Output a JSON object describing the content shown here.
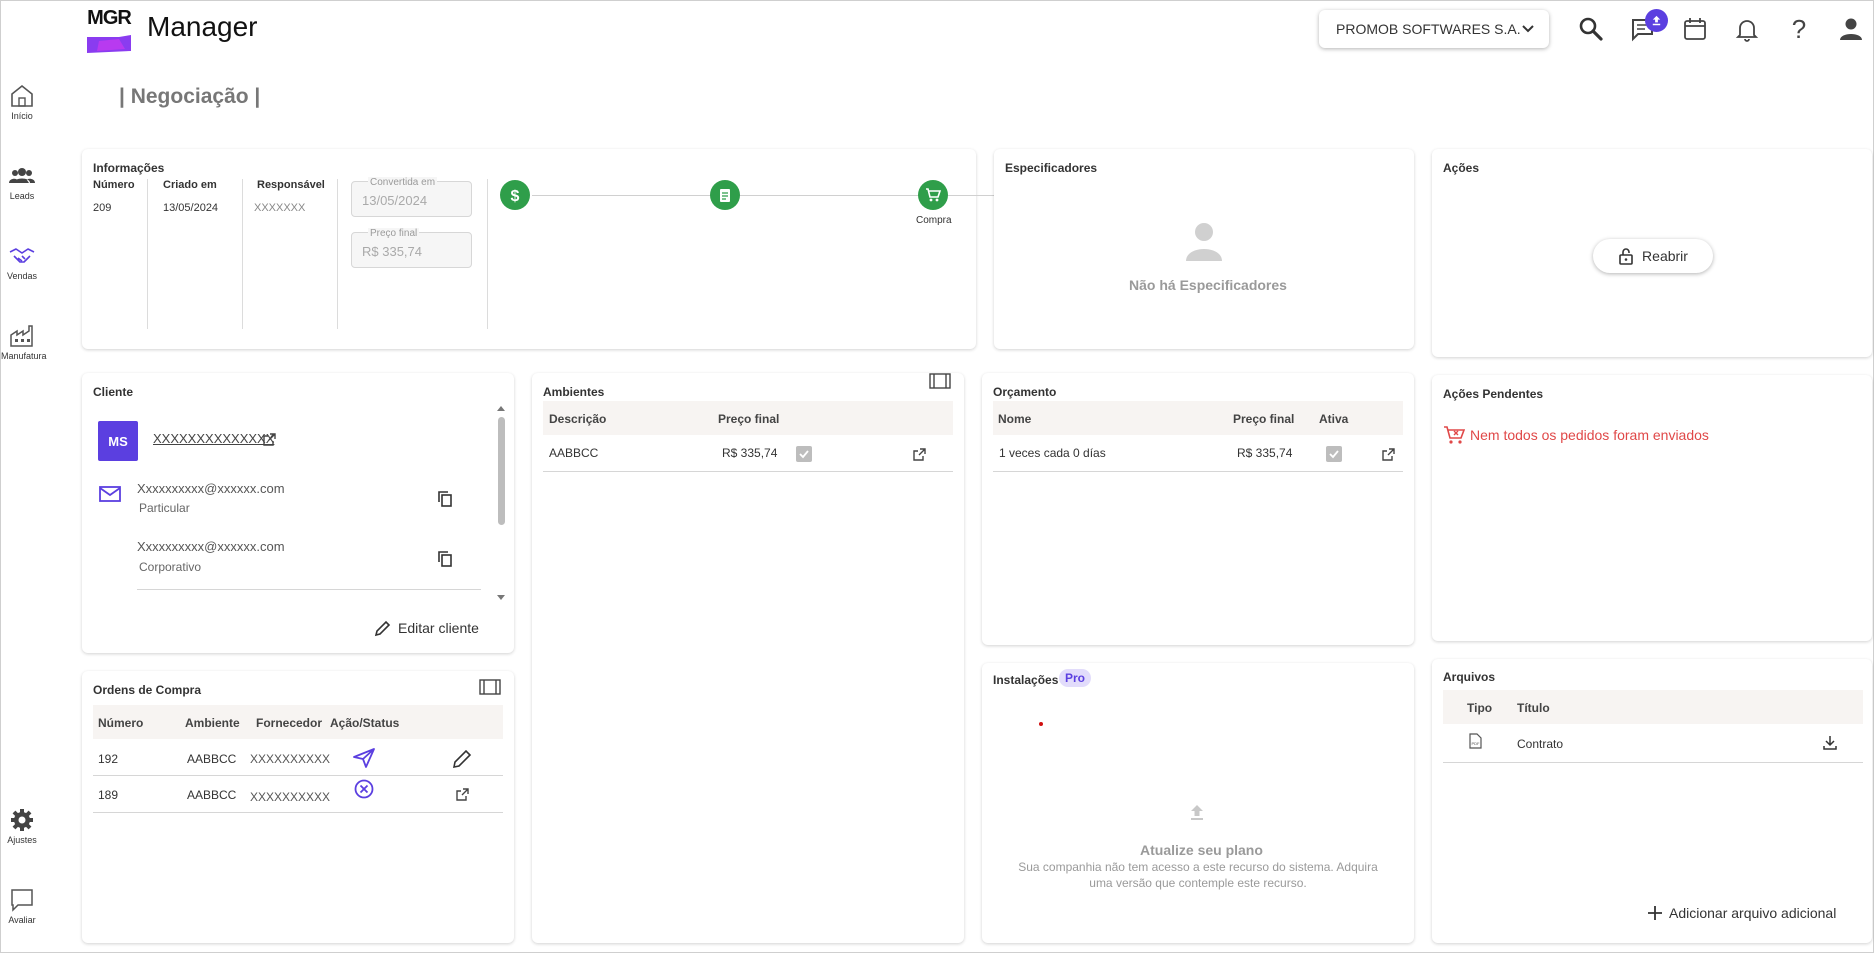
{
  "app": {
    "logo_text": "MGR",
    "title": "Manager"
  },
  "header": {
    "company": "PROMOB SOFTWARES S.A."
  },
  "sidebar": {
    "items": [
      {
        "label": "Início",
        "icon": "home-icon"
      },
      {
        "label": "Leads",
        "icon": "people-icon"
      },
      {
        "label": "Vendas",
        "icon": "handshake-icon"
      },
      {
        "label": "Manufatura",
        "icon": "factory-icon"
      },
      {
        "label": "Ajustes",
        "icon": "gear-icon"
      },
      {
        "label": "Avaliar",
        "icon": "chat-icon"
      }
    ]
  },
  "page": {
    "title": "| Negociação |"
  },
  "info": {
    "title": "Informações",
    "numero_label": "Número",
    "numero": "209",
    "criado_label": "Criado em",
    "criado": "13/05/2024",
    "responsavel_label": "Responsável",
    "responsavel": "XXXXXXX",
    "convertida_label": "Convertida em",
    "convertida": "13/05/2024",
    "preco_label": "Preço final",
    "preco": "R$ 335,74",
    "step_label": "Compra"
  },
  "especificadores": {
    "title": "Especificadores",
    "empty": "Não há Especificadores"
  },
  "acoes": {
    "title": "Ações",
    "reabrir": "Reabrir"
  },
  "cliente": {
    "title": "Cliente",
    "initials": "MS",
    "name": "XXXXXXXXXXXXXX",
    "email1": "Xxxxxxxxxx@xxxxxx.com",
    "email1_type": "Particular",
    "email2": "Xxxxxxxxxx@xxxxxx.com",
    "email2_type": "Corporativo",
    "edit": "Editar cliente"
  },
  "ambientes": {
    "title": "Ambientes",
    "headers": [
      "Descrição",
      "Preço final"
    ],
    "rows": [
      {
        "descricao": "AABBCC",
        "preco": "R$ 335,74"
      }
    ]
  },
  "orcamento": {
    "title": "Orçamento",
    "headers": [
      "Nome",
      "Preço final",
      "Ativa"
    ],
    "rows": [
      {
        "nome": "1 veces cada 0 días",
        "preco": "R$ 335,74"
      }
    ]
  },
  "pendentes": {
    "title": "Ações Pendentes",
    "message": "Nem todos os pedidos foram enviados"
  },
  "ordens": {
    "title": "Ordens de Compra",
    "headers": [
      "Número",
      "Ambiente",
      "Fornecedor",
      "Ação/Status"
    ],
    "rows": [
      {
        "numero": "192",
        "ambiente": "AABBCC",
        "fornecedor": "XXXXXXXXXX"
      },
      {
        "numero": "189",
        "ambiente": "AABBCC",
        "fornecedor": "XXXXXXXXXX"
      }
    ]
  },
  "instalacoes": {
    "title": "Instalações",
    "badge": "Pro",
    "upgrade_title": "Atualize seu plano",
    "upgrade_desc": "Sua companhia não tem acesso a este recurso do sistema. Adquira uma versão que contemple este recurso."
  },
  "arquivos": {
    "title": "Arquivos",
    "headers": [
      "Tipo",
      "Título"
    ],
    "rows": [
      {
        "titulo": "Contrato"
      }
    ],
    "add": "Adicionar arquivo adicional"
  },
  "colors": {
    "accent": "#5b3fe0",
    "success": "#2f9e4a",
    "danger": "#e04848"
  }
}
